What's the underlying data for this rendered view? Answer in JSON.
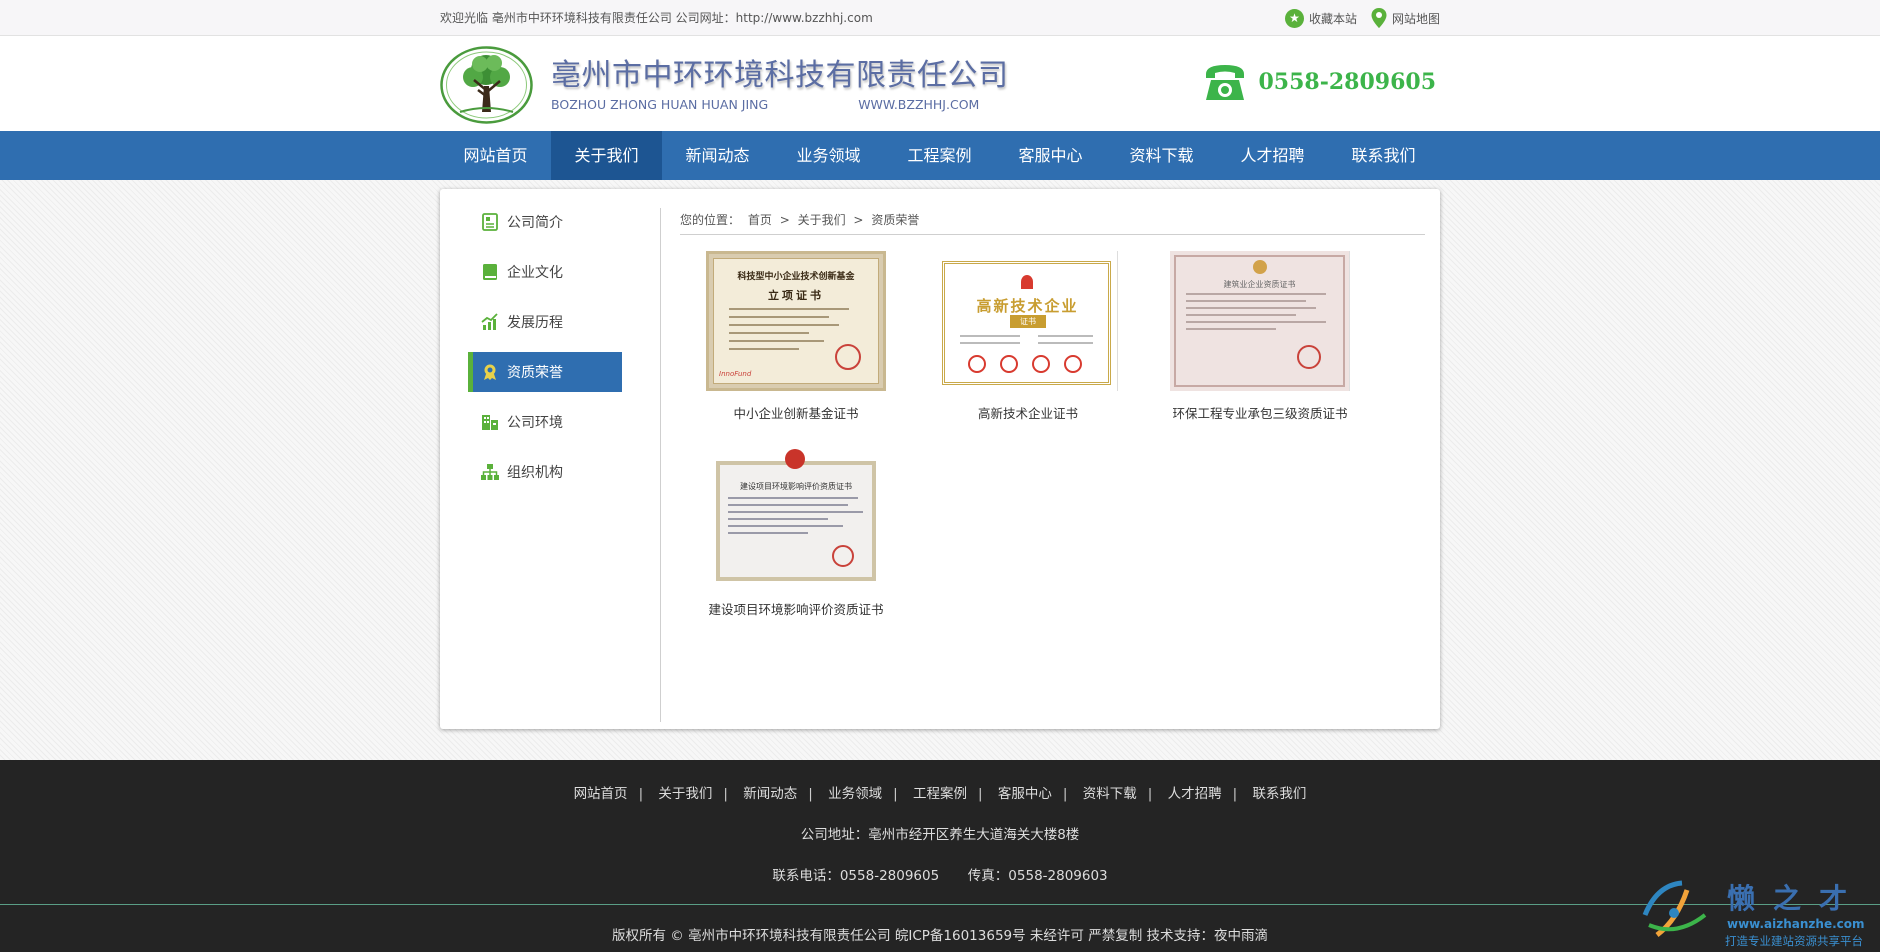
{
  "topbar": {
    "welcome": "欢迎光临 亳州市中环环境科技有限责任公司 公司网址：http://www.bzzhhj.com",
    "favorite": "收藏本站",
    "sitemap": "网站地图"
  },
  "header": {
    "company": "亳州市中环环境科技有限责任公司",
    "pinyin": "BOZHOU ZHONG HUAN HUAN JING",
    "domain": "WWW.BZZHHJ.COM",
    "phone": "0558-2809605"
  },
  "nav": [
    "网站首页",
    "关于我们",
    "新闻动态",
    "业务领域",
    "工程案例",
    "客服中心",
    "资料下载",
    "人才招聘",
    "联系我们"
  ],
  "sidebar": [
    "公司简介",
    "企业文化",
    "发展历程",
    "资质荣誉",
    "公司环境",
    "组织机构"
  ],
  "breadcrumb": {
    "label": "您的位置：",
    "home": "首页",
    "sep": ">",
    "parent": "关于我们",
    "current": "资质荣誉"
  },
  "certificates": [
    {
      "caption": "中小企业创新基金证书",
      "header": "科技型中小企业技术创新基金",
      "title": "立项证书",
      "badge": "InnoFund"
    },
    {
      "caption": "高新技术企业证书",
      "header": "高新技术企业",
      "title": "证书"
    },
    {
      "caption": "环保工程专业承包三级资质证书",
      "header": "建筑业企业资质证书"
    },
    {
      "caption": "建设项目环境影响评价资质证书",
      "header": "建设项目环境影响评价资质证书"
    }
  ],
  "footer": {
    "nav": [
      "网站首页",
      "关于我们",
      "新闻动态",
      "业务领域",
      "工程案例",
      "客服中心",
      "资料下载",
      "人才招聘",
      "联系我们"
    ],
    "address": "公司地址：亳州市经开区养生大道海关大楼8楼",
    "phone": "联系电话：0558-2809605",
    "fax": "传真：0558-2809603",
    "copyright": "版权所有 ©   亳州市中环环境科技有限责任公司   皖ICP备16013659号   未经许可 严禁复制   技术支持：夜中雨滴"
  },
  "watermark": {
    "brand": "懒之才",
    "url": "www.aizhanzhe.com",
    "slogan": "打造专业建站资源共享平台"
  },
  "colors": {
    "nav_blue": "#2f6eb0",
    "nav_active": "#1d5592",
    "accent_green": "#5ab13b",
    "phone_green": "#3cb44a",
    "footer_bg": "#242424"
  }
}
